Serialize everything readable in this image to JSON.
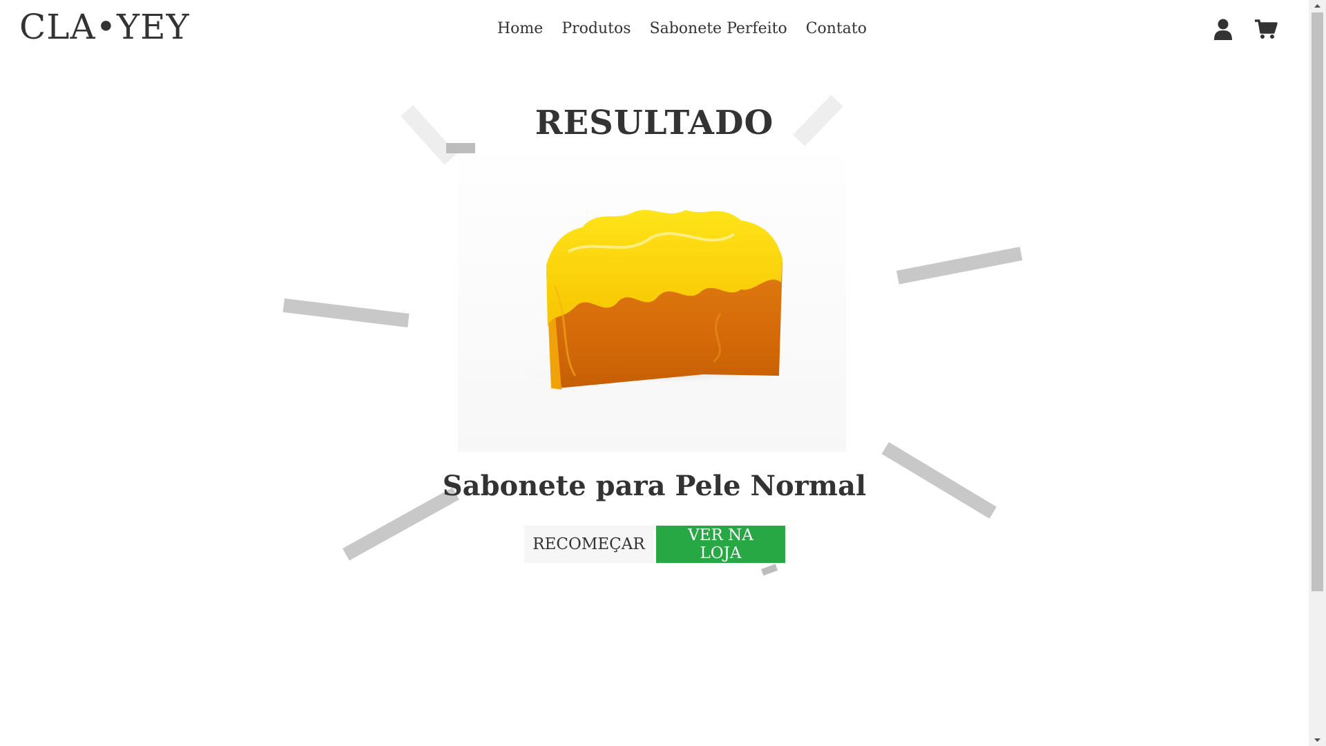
{
  "header": {
    "logo": "CLA•YEY",
    "nav": [
      "Home",
      "Produtos",
      "Sabonete Perfeito",
      "Contato"
    ],
    "icons": [
      "user-icon",
      "cart-icon"
    ]
  },
  "result": {
    "title": "RESULTADO",
    "product_name": "Sabonete para Pele Normal",
    "restart_label": "RECOMEÇAR",
    "store_label": "VER NA LOJA"
  },
  "colors": {
    "primary_button": "#28a745",
    "secondary_button": "#f6f6f6",
    "text": "#333333",
    "confetti": "#c8c8c8"
  }
}
